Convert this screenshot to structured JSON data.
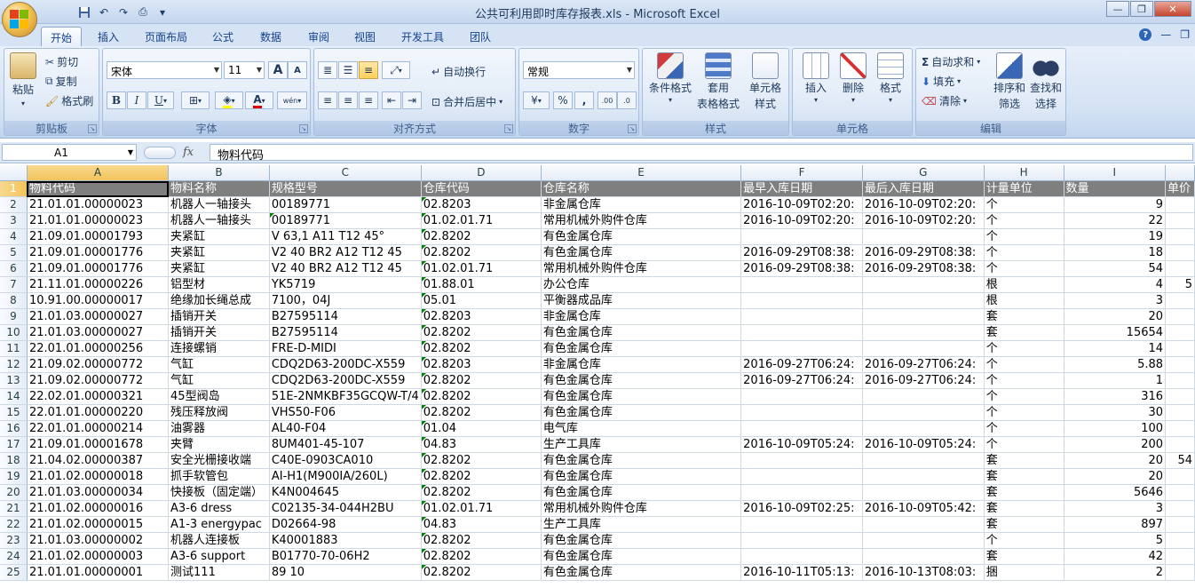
{
  "window": {
    "title": "公共可利用即时库存报表.xls - Microsoft Excel",
    "minimize": "—",
    "restore": "❐",
    "close": "✕"
  },
  "tabs": [
    {
      "label": "开始",
      "active": true
    },
    {
      "label": "插入"
    },
    {
      "label": "页面布局"
    },
    {
      "label": "公式"
    },
    {
      "label": "数据"
    },
    {
      "label": "审阅"
    },
    {
      "label": "视图"
    },
    {
      "label": "开发工具"
    },
    {
      "label": "团队"
    }
  ],
  "ribbon": {
    "clipboard": {
      "paste": "粘贴",
      "cut": "剪切",
      "copy": "复制",
      "format_painter": "格式刷",
      "label": "剪贴板"
    },
    "font": {
      "name": "宋体",
      "size": "11",
      "grow": "A",
      "shrink": "A",
      "bold": "B",
      "italic": "I",
      "underline": "U",
      "label": "字体",
      "phonetic": "wén"
    },
    "alignment": {
      "wrap": "自动换行",
      "merge": "合并后居中",
      "label": "对齐方式"
    },
    "number": {
      "format": "常规",
      "percent": "%",
      "comma": ",",
      "label": "数字"
    },
    "styles": {
      "conditional": "条件格式",
      "table_format_1": "套用",
      "table_format_2": "表格格式",
      "cell_styles_1": "单元格",
      "cell_styles_2": "样式",
      "label": "样式"
    },
    "cells": {
      "insert": "插入",
      "delete": "删除",
      "format": "格式",
      "label": "单元格"
    },
    "editing": {
      "autosum": "自动求和",
      "fill": "填充",
      "clear": "清除",
      "sort_1": "排序和",
      "sort_2": "筛选",
      "find_1": "查找和",
      "find_2": "选择",
      "sigma": "Σ",
      "label": "编辑"
    }
  },
  "formula_bar": {
    "cell_ref": "A1",
    "fx": "fx",
    "content": "物料代码"
  },
  "sheet": {
    "columns": [
      "A",
      "B",
      "C",
      "D",
      "E",
      "F",
      "G",
      "H",
      "I",
      ""
    ],
    "header": [
      "物料代码",
      "物料名称",
      "规格型号",
      "仓库代码",
      "仓库名称",
      "最早入库日期",
      "最后入库日期",
      "计量单位",
      "数量",
      "单价"
    ],
    "rows": [
      [
        "21.01.01.00000023",
        "机器人一轴接头",
        "00189771",
        "02.8203",
        "非金属仓库",
        "2016-10-09T02:20:",
        "2016-10-09T02:20:",
        "个",
        "9",
        ""
      ],
      [
        "21.01.01.00000023",
        "机器人一轴接头",
        "00189771",
        "01.02.01.71",
        "常用机械外购件仓库",
        "2016-10-09T02:20:",
        "2016-10-09T02:20:",
        "个",
        "22",
        ""
      ],
      [
        "21.09.01.00001793",
        "夹紧缸",
        "V 63,1 A11 T12 45°",
        "02.8202",
        "有色金属仓库",
        "",
        "",
        "个",
        "19",
        ""
      ],
      [
        "21.09.01.00001776",
        "夹紧缸",
        "V2 40 BR2 A12 T12 45",
        "02.8202",
        "有色金属仓库",
        "2016-09-29T08:38:",
        "2016-09-29T08:38:",
        "个",
        "18",
        ""
      ],
      [
        "21.09.01.00001776",
        "夹紧缸",
        "V2 40 BR2 A12 T12 45",
        "01.02.01.71",
        "常用机械外购件仓库",
        "2016-09-29T08:38:",
        "2016-09-29T08:38:",
        "个",
        "54",
        ""
      ],
      [
        "21.11.01.00000226",
        "铝型材",
        "YK5719",
        "01.88.01",
        "办公仓库",
        "",
        "",
        "根",
        "4",
        "5"
      ],
      [
        "10.91.00.00000017",
        "绝缘加长绳总成",
        "7100，04J",
        "05.01",
        "平衡器成品库",
        "",
        "",
        "根",
        "3",
        ""
      ],
      [
        "21.01.03.00000027",
        "插销开关",
        "B27595114",
        "02.8203",
        "非金属仓库",
        "",
        "",
        "套",
        "20",
        ""
      ],
      [
        "21.01.03.00000027",
        "插销开关",
        "B27595114",
        "02.8202",
        "有色金属仓库",
        "",
        "",
        "套",
        "15654",
        ""
      ],
      [
        "22.01.01.00000256",
        "连接螺销",
        "FRE-D-MIDI",
        "02.8202",
        "有色金属仓库",
        "",
        "",
        "个",
        "14",
        ""
      ],
      [
        "21.09.02.00000772",
        "气缸",
        "CDQ2D63-200DC-X559",
        "02.8203",
        "非金属仓库",
        "2016-09-27T06:24:",
        "2016-09-27T06:24:",
        "个",
        "5.88",
        ""
      ],
      [
        "21.09.02.00000772",
        "气缸",
        "CDQ2D63-200DC-X559",
        "02.8202",
        "有色金属仓库",
        "2016-09-27T06:24:",
        "2016-09-27T06:24:",
        "个",
        "1",
        ""
      ],
      [
        "22.02.01.00000321",
        "45型阀岛",
        "51E-2NMKBF35GCQW-T/4",
        "02.8202",
        "有色金属仓库",
        "",
        "",
        "个",
        "316",
        ""
      ],
      [
        "22.01.01.00000220",
        "残压释放阀",
        "VHS50-F06",
        "02.8202",
        "有色金属仓库",
        "",
        "",
        "个",
        "30",
        ""
      ],
      [
        "22.01.01.00000214",
        "油雾器",
        "AL40-F04",
        "01.04",
        "电气库",
        "",
        "",
        "个",
        "100",
        ""
      ],
      [
        "21.09.01.00001678",
        "夹臂",
        "8UM401-45-107",
        "04.83",
        "生产工具库",
        "2016-10-09T05:24:",
        "2016-10-09T05:24:",
        "个",
        "200",
        ""
      ],
      [
        "21.04.02.00000387",
        "安全光栅接收端",
        "C40E-0903CA010",
        "02.8202",
        "有色金属仓库",
        "",
        "",
        "套",
        "20",
        "54"
      ],
      [
        "21.01.02.00000018",
        "抓手软管包",
        "AI-H1(M900IA/260L)",
        "02.8202",
        "有色金属仓库",
        "",
        "",
        "套",
        "20",
        ""
      ],
      [
        "21.01.03.00000034",
        "快接板（固定端）",
        "K4N004645",
        "02.8202",
        "有色金属仓库",
        "",
        "",
        "套",
        "5646",
        ""
      ],
      [
        "21.01.02.00000016",
        "A3-6 dress",
        "C02135-34-044H2BU",
        "01.02.01.71",
        "常用机械外购件仓库",
        "2016-10-09T02:25:",
        "2016-10-09T05:42:",
        "套",
        "3",
        ""
      ],
      [
        "21.01.02.00000015",
        "A1-3 energypac",
        "D02664-98",
        "04.83",
        "生产工具库",
        "",
        "",
        "套",
        "897",
        ""
      ],
      [
        "21.01.03.00000002",
        "机器人连接板",
        "K40001883",
        "02.8202",
        "有色金属仓库",
        "",
        "",
        "个",
        "5",
        ""
      ],
      [
        "21.01.02.00000003",
        "A3-6 support",
        "B01770-70-06H2",
        "02.8202",
        "有色金属仓库",
        "",
        "",
        "套",
        "42",
        ""
      ],
      [
        "21.01.01.00000001",
        "测试111",
        "89 10",
        "02.8202",
        "有色金属仓库",
        "2016-10-11T05:13:",
        "2016-10-13T08:03:",
        "捆",
        "2",
        ""
      ]
    ]
  }
}
